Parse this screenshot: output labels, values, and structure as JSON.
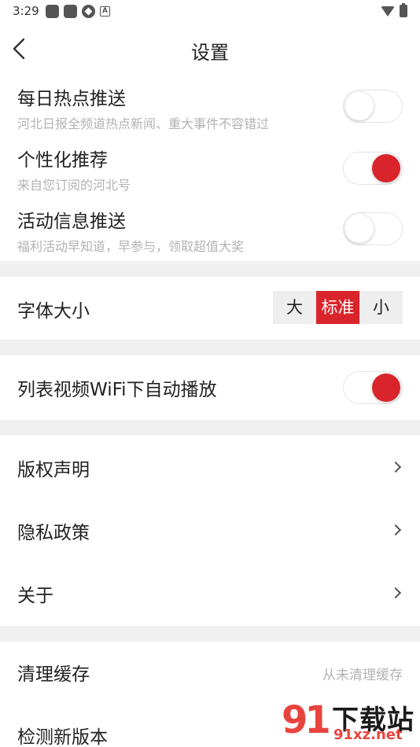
{
  "status_bar": {
    "time": "3:29",
    "left_icons": [
      "notification-square-icon",
      "notification-square-icon",
      "pinwheel-icon",
      "a-box-icon"
    ],
    "right_icons": [
      "wifi-icon",
      "battery-charging-icon"
    ],
    "a_box_glyph": "A"
  },
  "nav": {
    "title": "设置",
    "back_icon": "chevron-left-icon"
  },
  "push_settings": [
    {
      "title": "每日热点推送",
      "subtitle": "河北日报全频道热点新闻、重大事件不容错过",
      "enabled": false
    },
    {
      "title": "个性化推荐",
      "subtitle": "来自您订阅的河北号",
      "enabled": true
    },
    {
      "title": "活动信息推送",
      "subtitle": "福利活动早知道，早参与，领取超值大奖",
      "enabled": false
    }
  ],
  "font_size": {
    "title": "字体大小",
    "options": [
      "大",
      "标准",
      "小"
    ],
    "selected": "标准"
  },
  "video_autoplay": {
    "title": "列表视频WiFi下自动播放",
    "enabled": true
  },
  "links": [
    {
      "title": "版权声明"
    },
    {
      "title": "隐私政策"
    },
    {
      "title": "关于"
    }
  ],
  "cache": {
    "title": "清理缓存",
    "value": "从未清理缓存"
  },
  "update": {
    "title": "检测新版本"
  },
  "watermark": {
    "logo": "91",
    "name": "下载站",
    "url": "91xz.net"
  },
  "colors": {
    "accent": "#d9242b",
    "divider": "#f0f0f0",
    "subtitle": "#b3b3b3"
  }
}
